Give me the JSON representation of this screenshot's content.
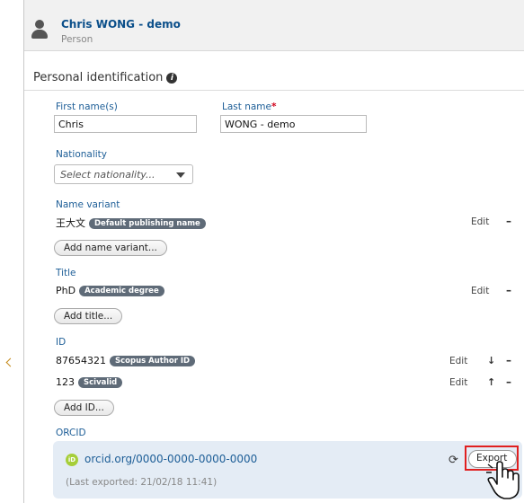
{
  "header": {
    "name": "Chris WONG - demo",
    "type": "Person"
  },
  "section": {
    "title": "Personal identification",
    "info_icon": "i"
  },
  "first_name": {
    "label": "First name(s)",
    "value": "Chris"
  },
  "last_name": {
    "label": "Last name",
    "required_mark": "*",
    "value": "WONG - demo"
  },
  "nationality": {
    "label": "Nationality",
    "placeholder": "Select nationality..."
  },
  "name_variant": {
    "label": "Name variant",
    "value": "王大文",
    "badge": "Default publishing name",
    "edit": "Edit",
    "remove": "–",
    "add_button": "Add name variant..."
  },
  "title": {
    "label": "Title",
    "value": "PhD",
    "badge": "Academic degree",
    "edit": "Edit",
    "remove": "–",
    "add_button": "Add title..."
  },
  "id": {
    "label": "ID",
    "items": [
      {
        "value": "87654321",
        "badge": "Scopus Author ID",
        "edit": "Edit",
        "move": "↓",
        "remove": "–"
      },
      {
        "value": "123",
        "badge": "Scivalid",
        "edit": "Edit",
        "move": "↑",
        "remove": "–"
      }
    ],
    "add_button": "Add ID..."
  },
  "orcid": {
    "label": "ORCID",
    "logo": "iD",
    "link_prefix": "orcid.org/",
    "link_id": "0000-0000-0000-0000",
    "last_exported": "(Last exported: 21/02/18 11:41)",
    "refresh_icon": "⟳",
    "export_button": "Export",
    "remove": "–"
  },
  "colors": {
    "link": "#1d5e97",
    "badge": "#5f6b78",
    "orcid_bg": "#e4ecf5",
    "highlight": "#e02020",
    "required": "#d0021b"
  }
}
